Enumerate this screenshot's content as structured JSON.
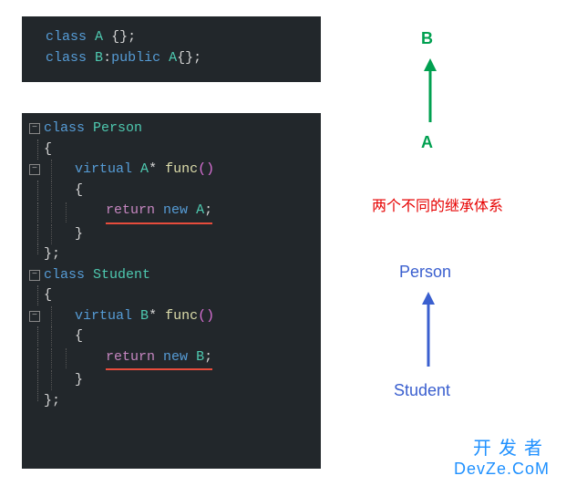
{
  "code1": {
    "l1": {
      "kw": "class",
      "name": "A",
      "body": "{};"
    },
    "l2": {
      "kw": "class",
      "name": "B",
      "colon": ":",
      "access": "public",
      "base": "A",
      "body": "{};"
    }
  },
  "code2": {
    "class1": {
      "kw": "class",
      "name": "Person",
      "open": "{",
      "virtual": "virtual",
      "rettype": "A",
      "star": "*",
      "fn": "func",
      "parens": "()",
      "bodyopen": "{",
      "ret": "return",
      "newkw": "new",
      "newtype": "A",
      "semi": ";",
      "bodyclose": "}",
      "close": "};"
    },
    "class2": {
      "kw": "class",
      "name": "Student",
      "open": "{",
      "virtual": "virtual",
      "rettype": "B",
      "star": "*",
      "fn": "func",
      "parens": "()",
      "bodyopen": "{",
      "ret": "return",
      "newkw": "new",
      "newtype": "B",
      "semi": ";",
      "bodyclose": "}",
      "close": "};"
    }
  },
  "labels": {
    "B": "B",
    "A": "A",
    "note": "两个不同的继承体系",
    "Person": "Person",
    "Student": "Student"
  },
  "fold": {
    "minus": "−"
  },
  "watermark": {
    "cn": "开发者",
    "en": "DevZe.CoM"
  }
}
